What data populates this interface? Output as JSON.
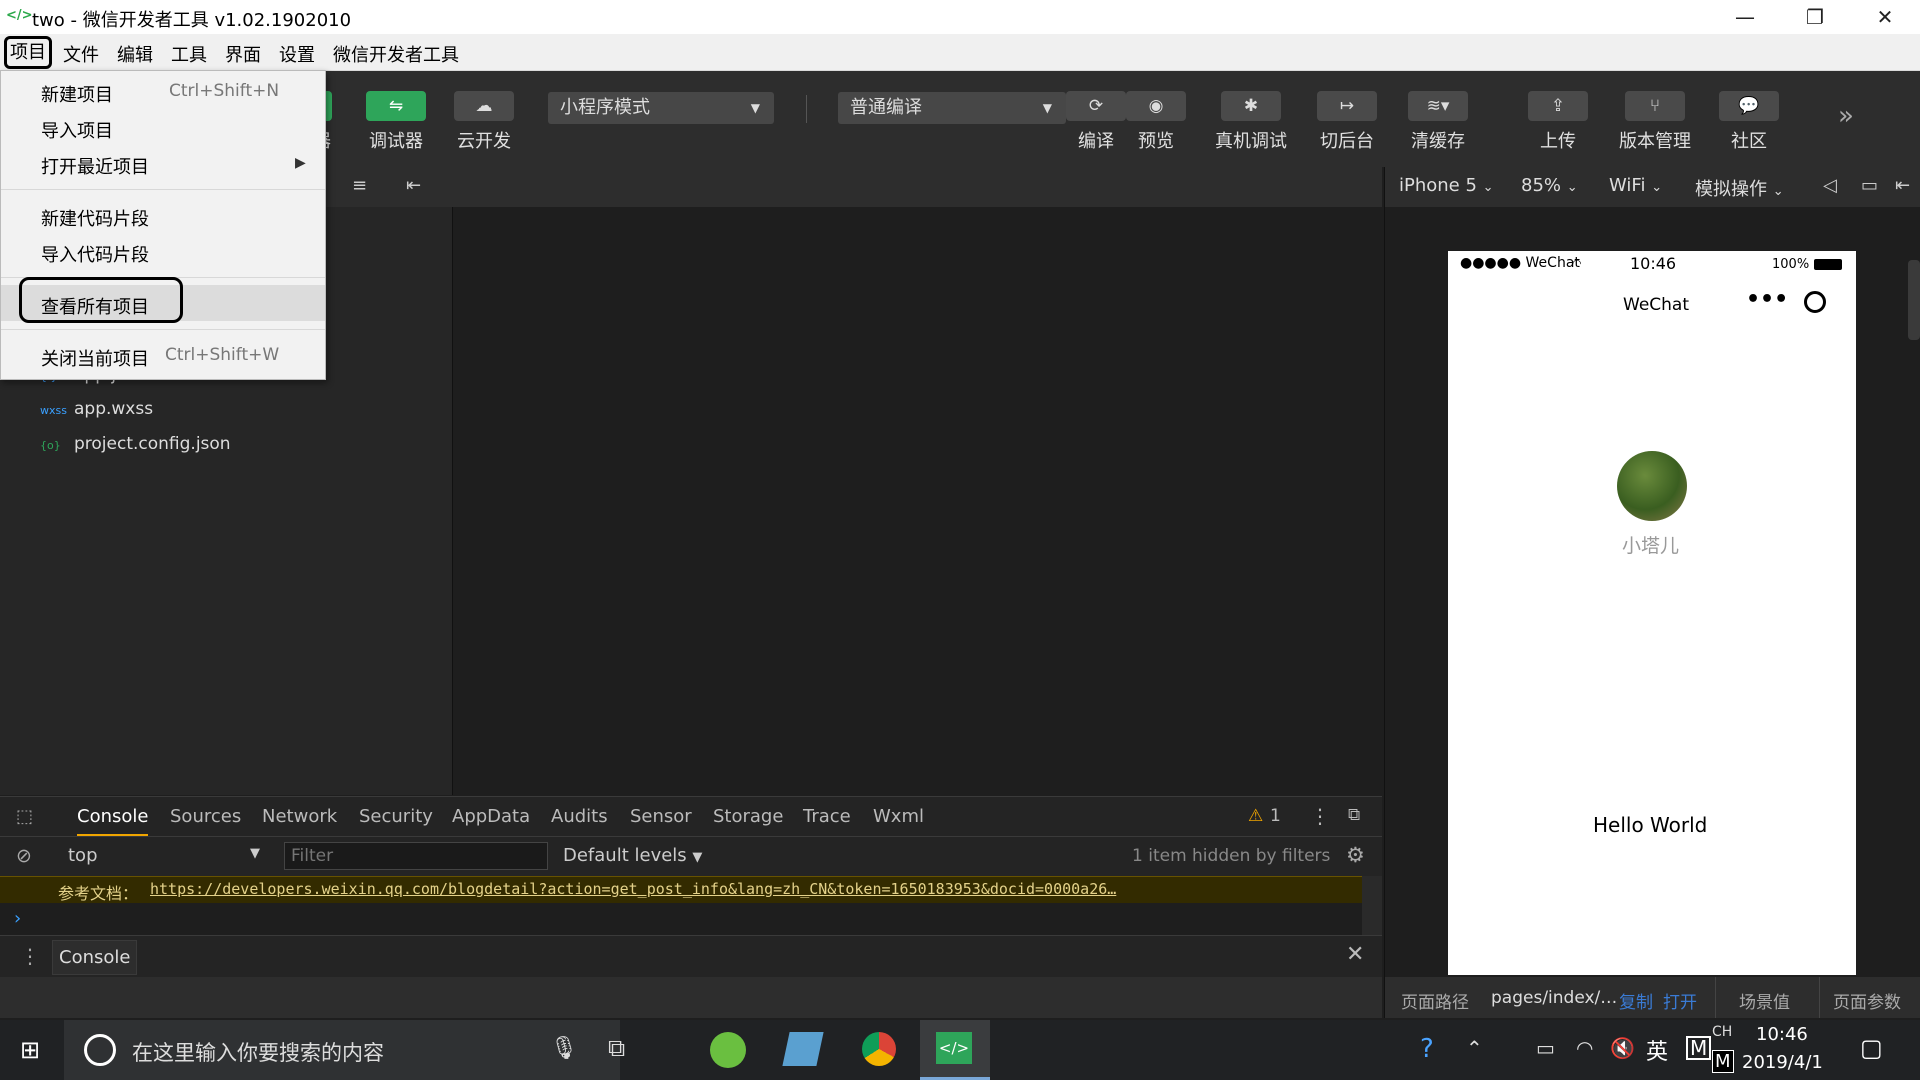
{
  "window": {
    "title": "two - 微信开发者工具 v1.02.1902010",
    "logo": "</>"
  },
  "menubar": [
    "项目",
    "文件",
    "编辑",
    "工具",
    "界面",
    "设置",
    "微信开发者工具"
  ],
  "toolbar": {
    "debugger": "调试器",
    "cloud": "云开发",
    "mode": "小程序模式",
    "compile_mode": "普通编译",
    "compile": "编译",
    "preview": "预览",
    "remote_debug": "真机调试",
    "background": "切后台",
    "clear_cache": "清缓存",
    "upload": "上传",
    "version": "版本管理",
    "community": "社区",
    "partial_label": "器"
  },
  "files": [
    {
      "icon": "{ }",
      "name": "app.json"
    },
    {
      "icon": "wxss",
      "name": "app.wxss"
    },
    {
      "icon": "{o}",
      "name": "project.config.json"
    }
  ],
  "project_menu": {
    "new_project": "新建项目",
    "new_project_shortcut": "Ctrl+Shift+N",
    "import_project": "导入项目",
    "open_recent": "打开最近项目",
    "new_snippet": "新建代码片段",
    "import_snippet": "导入代码片段",
    "view_all": "查看所有项目",
    "close_project": "关闭当前项目",
    "close_shortcut": "Ctrl+Shift+W"
  },
  "devtools": {
    "tabs": [
      "Console",
      "Sources",
      "Network",
      "Security",
      "AppData",
      "Audits",
      "Sensor",
      "Storage",
      "Trace",
      "Wxml"
    ],
    "warning_count": "1",
    "context": "top",
    "filter_placeholder": "Filter",
    "levels": "Default levels",
    "hidden": "1 item hidden by filters",
    "message_prefix": "参考文档：",
    "message_link": "https://developers.weixin.qq.com/blogdetail?action=get_post_info&lang=zh_CN&token=1650183953&docid=0000a26…",
    "drawer_tab": "Console"
  },
  "simulator": {
    "device": "iPhone 5",
    "zoom": "85%",
    "network": "WiFi",
    "ops": "模拟操作",
    "status_carrier": "●●●●● WeChat",
    "status_time": "10:46",
    "status_battery": "100%",
    "nav_title": "WeChat",
    "nickname": "小塔儿",
    "hello": "Hello World"
  },
  "sim_footer": {
    "path_label": "页面路径",
    "path": "pages/index/…",
    "copy": "复制",
    "open": "打开",
    "scene": "场景值",
    "params": "页面参数"
  },
  "taskbar": {
    "search_placeholder": "在这里输入你要搜索的内容",
    "time": "10:46",
    "date": "2019/4/1",
    "lang1": "CH",
    "lang2": "英",
    "ime": "M"
  },
  "colors": {
    "accent_green": "#2ea55a",
    "link_blue": "#3aa0ff",
    "warning": "#f0a500"
  }
}
